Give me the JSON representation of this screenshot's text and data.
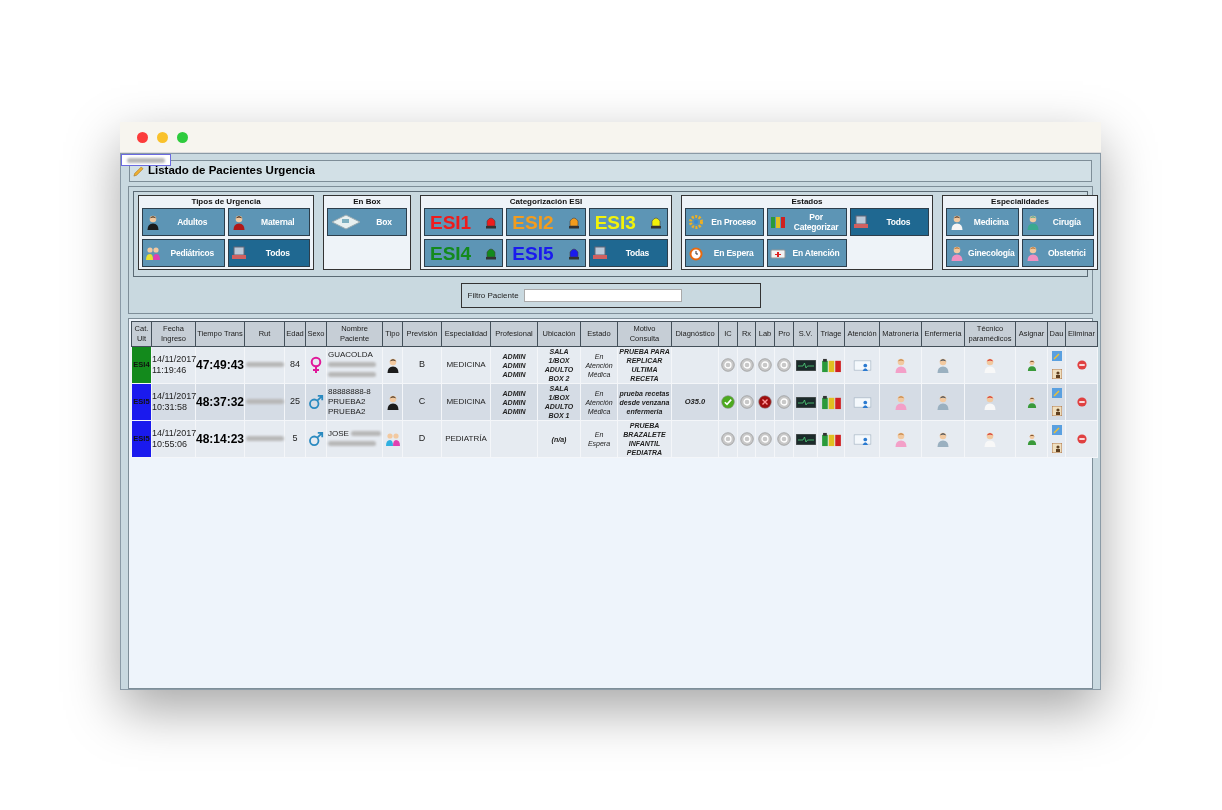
{
  "window": {
    "title": "Listado de Pacientes Urgencia"
  },
  "filter_groups": [
    {
      "title": "Tipos de Urgencia",
      "buttons": [
        {
          "label": "Adultos",
          "kind": "plain",
          "selected": false
        },
        {
          "label": "Maternal",
          "kind": "plain",
          "selected": false
        },
        {
          "label": "Pediátricos",
          "kind": "plain",
          "selected": false
        },
        {
          "label": "Todos",
          "kind": "plain",
          "selected": true
        }
      ]
    },
    {
      "title": "En Box",
      "buttons": [
        {
          "label": "Box",
          "kind": "plain",
          "selected": false
        }
      ]
    },
    {
      "title": "Categorización ESI",
      "buttons": [
        {
          "label": "ESI1",
          "kind": "esi",
          "color": "#ee1c1c",
          "selected": false
        },
        {
          "label": "ESI2",
          "kind": "esi",
          "color": "#f39c1e",
          "selected": false
        },
        {
          "label": "ESI3",
          "kind": "esi",
          "color": "#f2f20a",
          "selected": false
        },
        {
          "label": "ESI4",
          "kind": "esi",
          "color": "#138a1c",
          "selected": false
        },
        {
          "label": "ESI5",
          "kind": "esi",
          "color": "#1a1aee",
          "selected": false
        },
        {
          "label": "Todas",
          "kind": "plain",
          "selected": true
        }
      ]
    },
    {
      "title": "Estados",
      "buttons": [
        {
          "label": "En Proceso",
          "kind": "plain",
          "selected": false
        },
        {
          "label": "Por Categorizar",
          "kind": "plain",
          "selected": false
        },
        {
          "label": "Todos",
          "kind": "plain",
          "selected": true
        },
        {
          "label": "En Espera",
          "kind": "plain",
          "selected": false
        },
        {
          "label": "En Atención",
          "kind": "plain",
          "selected": false
        }
      ]
    },
    {
      "title": "Especialidades",
      "buttons": [
        {
          "label": "Medicina",
          "kind": "plain",
          "selected": false
        },
        {
          "label": "Cirugía",
          "kind": "plain",
          "selected": false
        },
        {
          "label": "Ginecología",
          "kind": "plain",
          "selected": false
        },
        {
          "label": "Obstetrici",
          "kind": "plain",
          "selected": false
        }
      ]
    }
  ],
  "patient_filter": {
    "label": "Filtro Paciente"
  },
  "table": {
    "columns": [
      "Cat. Ult",
      "Fecha Ingreso",
      "Tiempo Trans",
      "Rut",
      "Edad",
      "Sexo",
      "Nombre Paciente",
      "Tipo",
      "Previsión",
      "Especialidad",
      "Profesional",
      "Ubicación",
      "Estado",
      "Motivo Consulta",
      "Diagnóstico",
      "IC",
      "Rx",
      "Lab",
      "Pro",
      "S.V.",
      "Triage",
      "Atención",
      "Matronería",
      "Enfermería",
      "Técnico paramédicos",
      "Asignar",
      "Dau",
      "Eliminar"
    ],
    "rows": [
      {
        "category": "ESI4",
        "color": "#138a1c",
        "date": "14/11/2017",
        "time": "11:19:46",
        "elapsed": "47:49:43",
        "rut_redacted": true,
        "age": "84",
        "female": true,
        "name_lines": [
          {
            "text": "GUACOLDA"
          },
          {
            "redacted": true
          },
          {
            "redacted": true
          }
        ],
        "child": false,
        "prevision": "B",
        "specialty": "MEDICINA",
        "professional": [
          "ADMIN",
          "ADMIN",
          "ADMIN"
        ],
        "location": [
          "SALA",
          "1/BOX",
          "ADULTO",
          "BOX 2"
        ],
        "status": [
          "En",
          "Atención",
          "Médica"
        ],
        "reason": [
          "PRUEBA PARA",
          "REPLICAR",
          "ULTIMA",
          "RECETA"
        ],
        "tests": [
          {
            "done": false,
            "failed": false
          },
          {
            "done": false,
            "failed": false
          },
          {
            "done": false,
            "failed": false
          },
          {
            "done": false,
            "failed": false
          }
        ]
      },
      {
        "category": "ESI5",
        "color": "#1a1aee",
        "date": "14/11/2017",
        "time": "10:31:58",
        "elapsed": "48:37:32",
        "rut_redacted": true,
        "age": "25",
        "female": false,
        "name_lines": [
          {
            "text": "88888888-8"
          },
          {
            "text": "PRUEBA2"
          },
          {
            "text": "PRUEBA2"
          }
        ],
        "child": false,
        "prevision": "C",
        "specialty": "MEDICINA",
        "professional": [
          "ADMIN",
          "ADMIN",
          "ADMIN"
        ],
        "location": [
          "SALA",
          "1/BOX",
          "ADULTO",
          "BOX 1"
        ],
        "status": [
          "En",
          "Atención",
          "Médica"
        ],
        "reason": [
          "prueba recetas",
          "desde venzana",
          "enfermeria"
        ],
        "diagnosis": "O35.0",
        "tests": [
          {
            "done": true,
            "failed": false
          },
          {
            "done": false,
            "failed": false
          },
          {
            "done": false,
            "failed": true
          },
          {
            "done": false,
            "failed": false
          }
        ]
      },
      {
        "category": "ESI5",
        "color": "#1a1aee",
        "date": "14/11/2017",
        "time": "10:55:06",
        "elapsed": "48:14:23",
        "rut_redacted": true,
        "age": "5",
        "female": false,
        "name_lines": [
          {
            "text": "JOSE",
            "redacted": true
          },
          {
            "redacted": true
          }
        ],
        "child": true,
        "prevision": "D",
        "specialty": "PEDIATRÍA",
        "professional": [],
        "location": [
          "(n/a)"
        ],
        "status": [
          "En",
          "Espera"
        ],
        "reason": [
          "PRUEBA",
          "BRAZALETE",
          "INFANTIL",
          "PEDIATRA"
        ],
        "tests": [
          {
            "done": false,
            "failed": false
          },
          {
            "done": false,
            "failed": false
          },
          {
            "done": false,
            "failed": false
          },
          {
            "done": false,
            "failed": false
          }
        ]
      }
    ]
  }
}
